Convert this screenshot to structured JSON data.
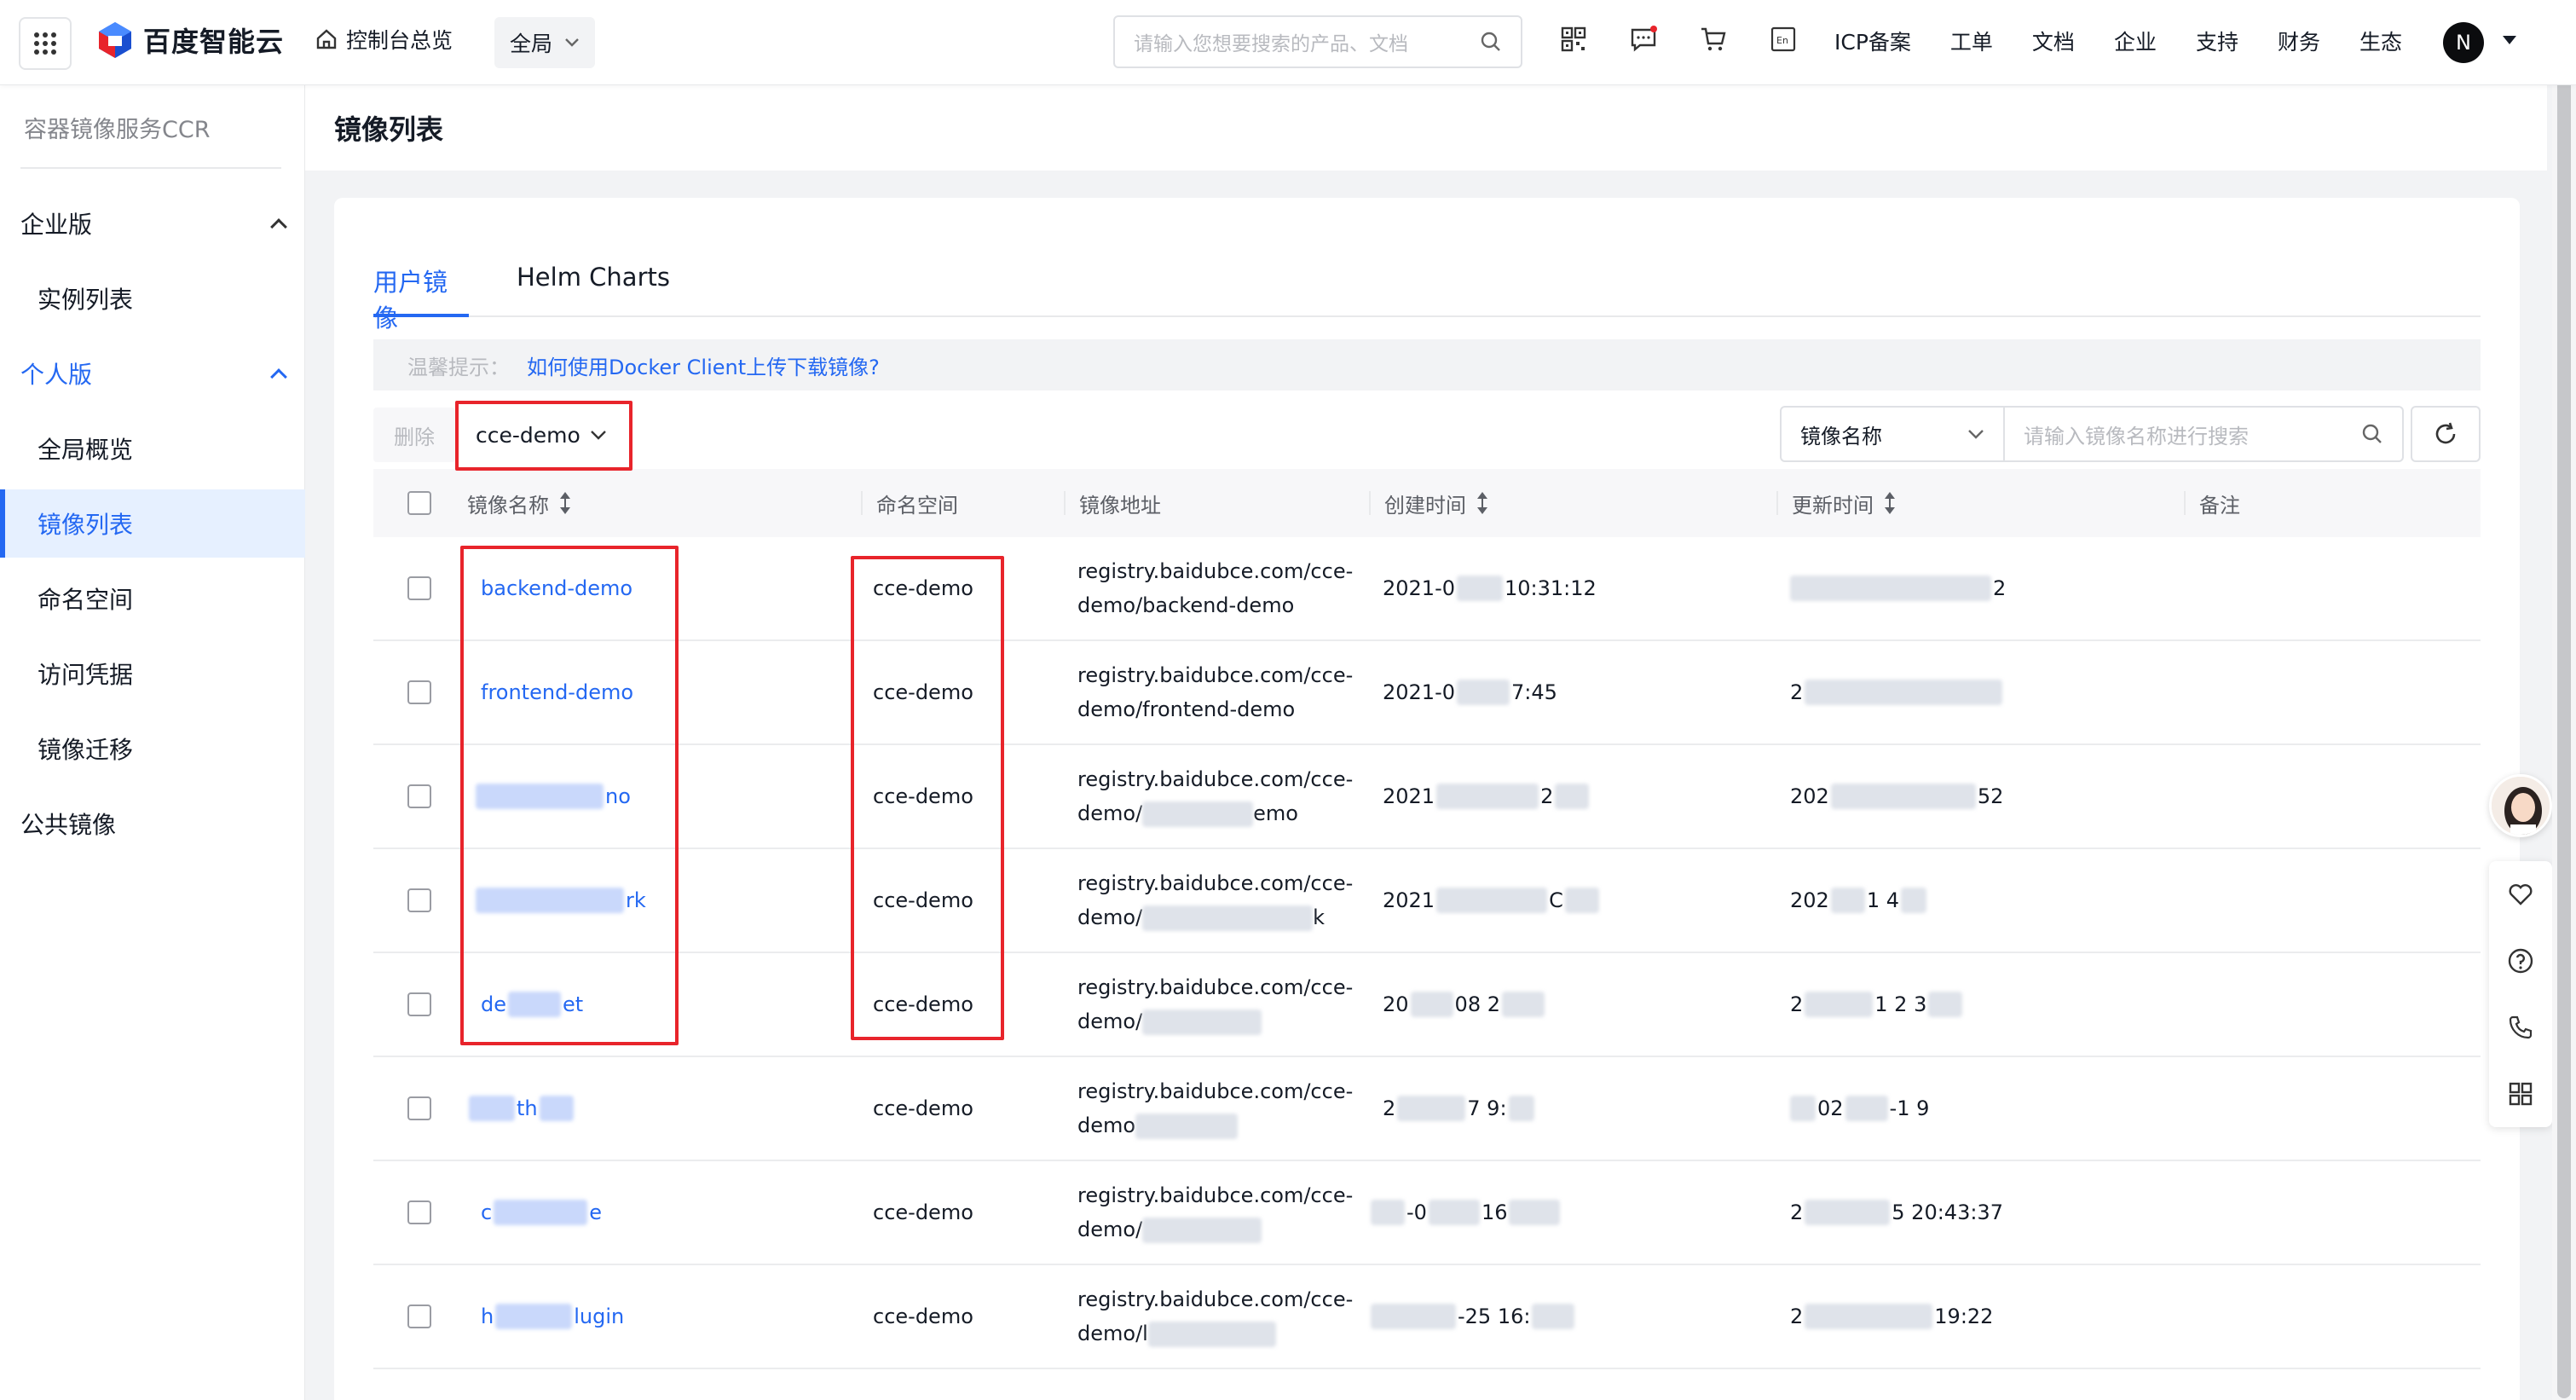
{
  "topbar": {
    "logo_text": "百度智能云",
    "home_label": "控制台总览",
    "scope_label": "全局",
    "search_placeholder": "请输入您想要搜索的产品、文档",
    "nav": [
      "ICP备案",
      "工单",
      "文档",
      "企业",
      "支持",
      "财务",
      "生态"
    ],
    "avatar_initial": "N",
    "icons": [
      "qrcode-icon",
      "message-icon",
      "cart-icon",
      "language-en-icon"
    ]
  },
  "sidebar": {
    "title": "容器镜像服务CCR",
    "groups": [
      {
        "label": "企业版",
        "expanded": true,
        "items": [
          "实例列表"
        ]
      },
      {
        "label": "个人版",
        "expanded": true,
        "items": [
          "全局概览",
          "镜像列表",
          "命名空间",
          "访问凭据",
          "镜像迁移"
        ]
      },
      {
        "label": "公共镜像",
        "expanded": false,
        "items": []
      }
    ],
    "active_item": "镜像列表"
  },
  "page": {
    "title": "镜像列表",
    "tabs": [
      "用户镜像",
      "Helm Charts"
    ],
    "active_tab": "用户镜像",
    "tip_label": "温馨提示：",
    "tip_link": "如何使用Docker Client上传下载镜像?",
    "delete_label": "删除",
    "namespace_select": "cce-demo",
    "search_type": "镜像名称",
    "search_placeholder": "请输入镜像名称进行搜索"
  },
  "table": {
    "columns": [
      "镜像名称",
      "命名空间",
      "镜像地址",
      "创建时间",
      "更新时间",
      "备注"
    ],
    "rows": [
      {
        "name": "backend-demo",
        "namespace": "cce-demo",
        "address_1": "registry.baidubce.com/cce-",
        "address_2": "demo/backend-demo",
        "created": "2021-0",
        "created_tail": "10:31:12",
        "updated": "",
        "updated_tail": "2"
      },
      {
        "name": "frontend-demo",
        "namespace": "cce-demo",
        "address_1": "registry.baidubce.com/cce-",
        "address_2": "demo/frontend-demo",
        "created": "2021-0",
        "created_tail": "7:45",
        "updated": "2",
        "updated_tail": ""
      },
      {
        "name": "no",
        "namespace": "cce-demo",
        "address_1": "registry.baidubce.com/cce-",
        "address_2": "demo/",
        "address_tail": "emo",
        "created": "2021",
        "created_tail": "2",
        "updated": "202",
        "updated_tail": "52"
      },
      {
        "name": "rk",
        "namespace": "cce-demo",
        "address_1": "registry.baidubce.com/cce-",
        "address_2": "demo/",
        "address_tail": "k",
        "created": "2021",
        "created_tail": "C",
        "updated": "202",
        "updated_tail": "1   4"
      },
      {
        "name": "de",
        "name_tail": "et",
        "namespace": "cce-demo",
        "address_1": "registry.baidubce.com/cce-",
        "address_2": "demo/",
        "address_tail": "",
        "created": "20",
        "created_tail": "08   2",
        "updated": "2",
        "updated_tail": "1 2   3"
      },
      {
        "name": "th",
        "namespace": "cce-demo",
        "address_1": "registry.baidubce.com/cce-",
        "address_2": "demo",
        "address_tail": "",
        "created": "2",
        "created_tail": "7   9:",
        "updated": "02",
        "updated_tail": "-1   9"
      },
      {
        "name": "c",
        "name_tail": "e",
        "namespace": "cce-demo",
        "address_1": "registry.baidubce.com/cce-",
        "address_2": "demo/",
        "address_tail": "",
        "created": "-0",
        "created_tail": "16",
        "updated": "2",
        "updated_tail": "5 20:43:37"
      },
      {
        "name": "h",
        "name_tail": "lugin",
        "namespace": "cce-demo",
        "address_1": "registry.baidubce.com/cce-",
        "address_2": "demo/l",
        "address_tail": "",
        "created": "",
        "created_tail": "-25 16:",
        "updated": "2",
        "updated_tail": "19:22"
      }
    ]
  },
  "colors": {
    "accent": "#2468f2",
    "annotation": "#e8242b",
    "text": "#151b26",
    "muted": "#84868c"
  }
}
